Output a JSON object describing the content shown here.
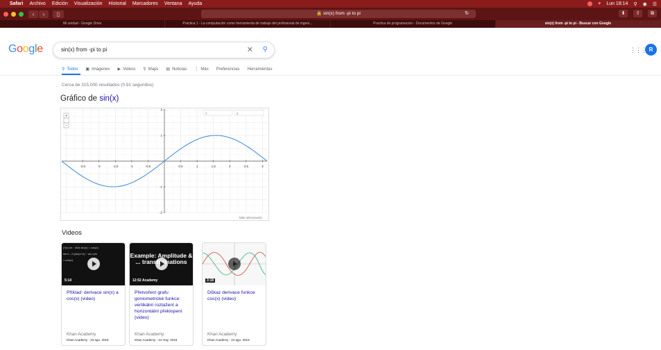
{
  "menubar": {
    "app": "Safari",
    "items": [
      "Archivo",
      "Edición",
      "Visualización",
      "Historial",
      "Marcadores",
      "Ventana",
      "Ayuda"
    ],
    "clock": "Lun 18:14"
  },
  "toolbar": {
    "url": "🔒 sin(x) from -pi to pi",
    "reload": "↻"
  },
  "tabs": [
    {
      "label": "Mi unidad - Google Drive",
      "active": false
    },
    {
      "label": "Práctica 1 - La computación como herramienta de trabajo del profesional de ingeni...",
      "active": false
    },
    {
      "label": "Practica de programacion - Documentos de Google",
      "active": false
    },
    {
      "label": "sin(x) from -pi to pi - Buscar con Google",
      "active": true
    }
  ],
  "search": {
    "query": "sin(x) from -pi to pi",
    "clear": "✕",
    "icon": "⚲"
  },
  "header": {
    "avatar_letter": "R",
    "apps": "⋮⋮⋮"
  },
  "nav": {
    "todos": "Todos",
    "imagenes": "Imágenes",
    "videos": "Videos",
    "maps": "Maps",
    "noticias": "Noticias",
    "mas": "Más",
    "preferencias": "Preferencias",
    "herramientas": "Herramientas"
  },
  "stats": "Cerca de 315,000 resultados (0.91 segundos)",
  "graph": {
    "title_prefix": "Gráfico de ",
    "title_fn": "sin(x)",
    "more_info": "Más información",
    "zoom_plus": "+",
    "zoom_minus": "−",
    "legend_x": "x:",
    "legend_y": "y:"
  },
  "chart_data": {
    "type": "line",
    "series": [
      {
        "name": "sin(x)",
        "function": "sin(x)"
      }
    ],
    "xlim": [
      -3.14,
      3.14
    ],
    "ylim": [
      -2,
      2
    ],
    "x_ticks": [
      "-2.5",
      "-2",
      "-1.5",
      "-1",
      "-0.5",
      "0.5",
      "1",
      "1.5",
      "2",
      "2.5",
      "3"
    ],
    "x_tick_values": [
      -2.5,
      -2,
      -1.5,
      -1,
      -0.5,
      0.5,
      1,
      1.5,
      2,
      2.5,
      3
    ],
    "y_ticks": [
      "2",
      "1",
      "-1",
      "-2"
    ],
    "y_tick_values": [
      2,
      1,
      -1,
      -2
    ],
    "grid": true,
    "color": "#4a90d9"
  },
  "videos": {
    "title": "Videos",
    "items": [
      {
        "title": "Příklad: derivace sin(x) a cos(x) (video)",
        "duration": "5:14",
        "channel": "Khan Academy",
        "meta": "Khan Academy - 23 ago. 2019"
      },
      {
        "title": "Přetvoření grafu goniometrické funkce: vertikální roztažení a horizontální překlopení (video)",
        "duration": "12:52",
        "overlay": "Example: Amplitude & ... transformations",
        "badge": "Academy",
        "channel": "Khan Academy",
        "meta": "Khan Academy - 24 may. 2018"
      },
      {
        "title": "Důkaz derivace funkce cos(x) (video)",
        "duration": "3:18",
        "channel": "Khan Academy",
        "meta": "Khan Academy - 24 ago. 2019"
      }
    ]
  }
}
